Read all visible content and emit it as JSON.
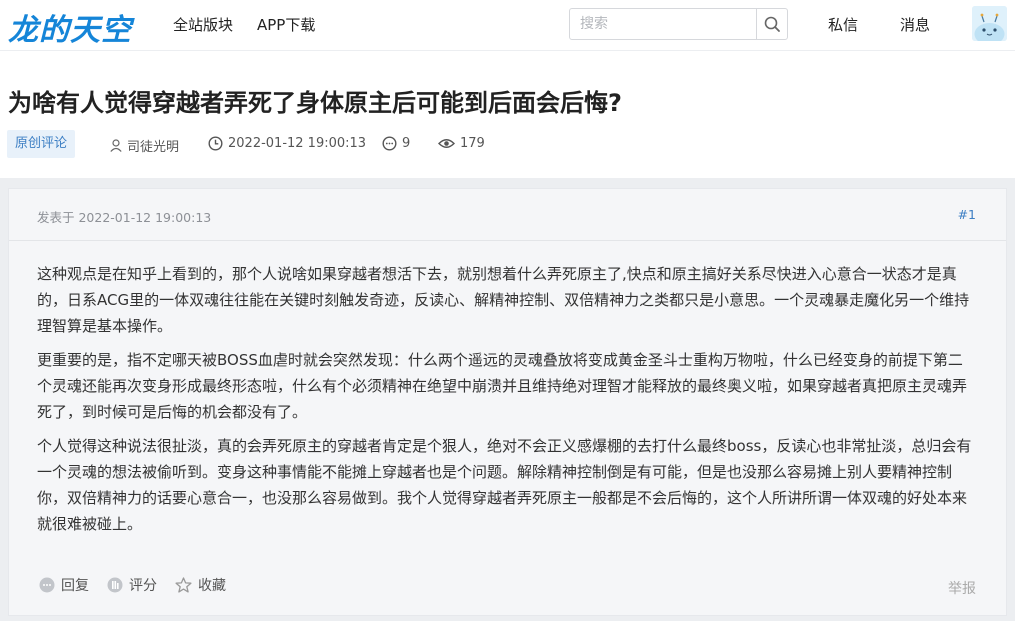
{
  "header": {
    "logo": "龙的天空",
    "nav": [
      "全站版块",
      "APP下载"
    ],
    "search_placeholder": "搜索",
    "messages_label": "私信",
    "notices_label": "消息"
  },
  "post": {
    "title": "为啥有人觉得穿越者弄死了身体原主后可能到后面会后悔?",
    "tag": "原创评论",
    "author": "司徒光明",
    "datetime": "2022-01-12 19:00:13",
    "replies": "9",
    "views": "179"
  },
  "floor": {
    "posted_label": "发表于 2022-01-12 19:00:13",
    "floor_number": "#1",
    "paragraphs": [
      "这种观点是在知乎上看到的，那个人说啥如果穿越者想活下去，就别想着什么弄死原主了,快点和原主搞好关系尽快进入心意合一状态才是真的，日系ACG里的一体双魂往往能在关键时刻触发奇迹，反读心、解精神控制、双倍精神力之类都只是小意思。一个灵魂暴走魔化另一个维持理智算是基本操作。",
      "更重要的是，指不定哪天被BOSS血虐时就会突然发现：什么两个遥远的灵魂叠放将变成黄金圣斗士重构万物啦，什么已经变身的前提下第二个灵魂还能再次变身形成最终形态啦，什么有个必须精神在绝望中崩溃并且维持绝对理智才能释放的最终奥义啦，如果穿越者真把原主灵魂弄死了，到时候可是后悔的机会都没有了。",
      "个人觉得这种说法很扯淡，真的会弄死原主的穿越者肯定是个狠人，绝对不会正义感爆棚的去打什么最终boss，反读心也非常扯淡，总归会有一个灵魂的想法被偷听到。变身这种事情能不能摊上穿越者也是个问题。解除精神控制倒是有可能，但是也没那么容易摊上别人要精神控制你，双倍精神力的话要心意合一，也没那么容易做到。我个人觉得穿越者弄死原主一般都是不会后悔的，这个人所讲所谓一体双魂的好处本来就很难被碰上。"
    ],
    "actions": {
      "reply": "回复",
      "rate": "评分",
      "favorite": "收藏",
      "report": "举报"
    }
  }
}
